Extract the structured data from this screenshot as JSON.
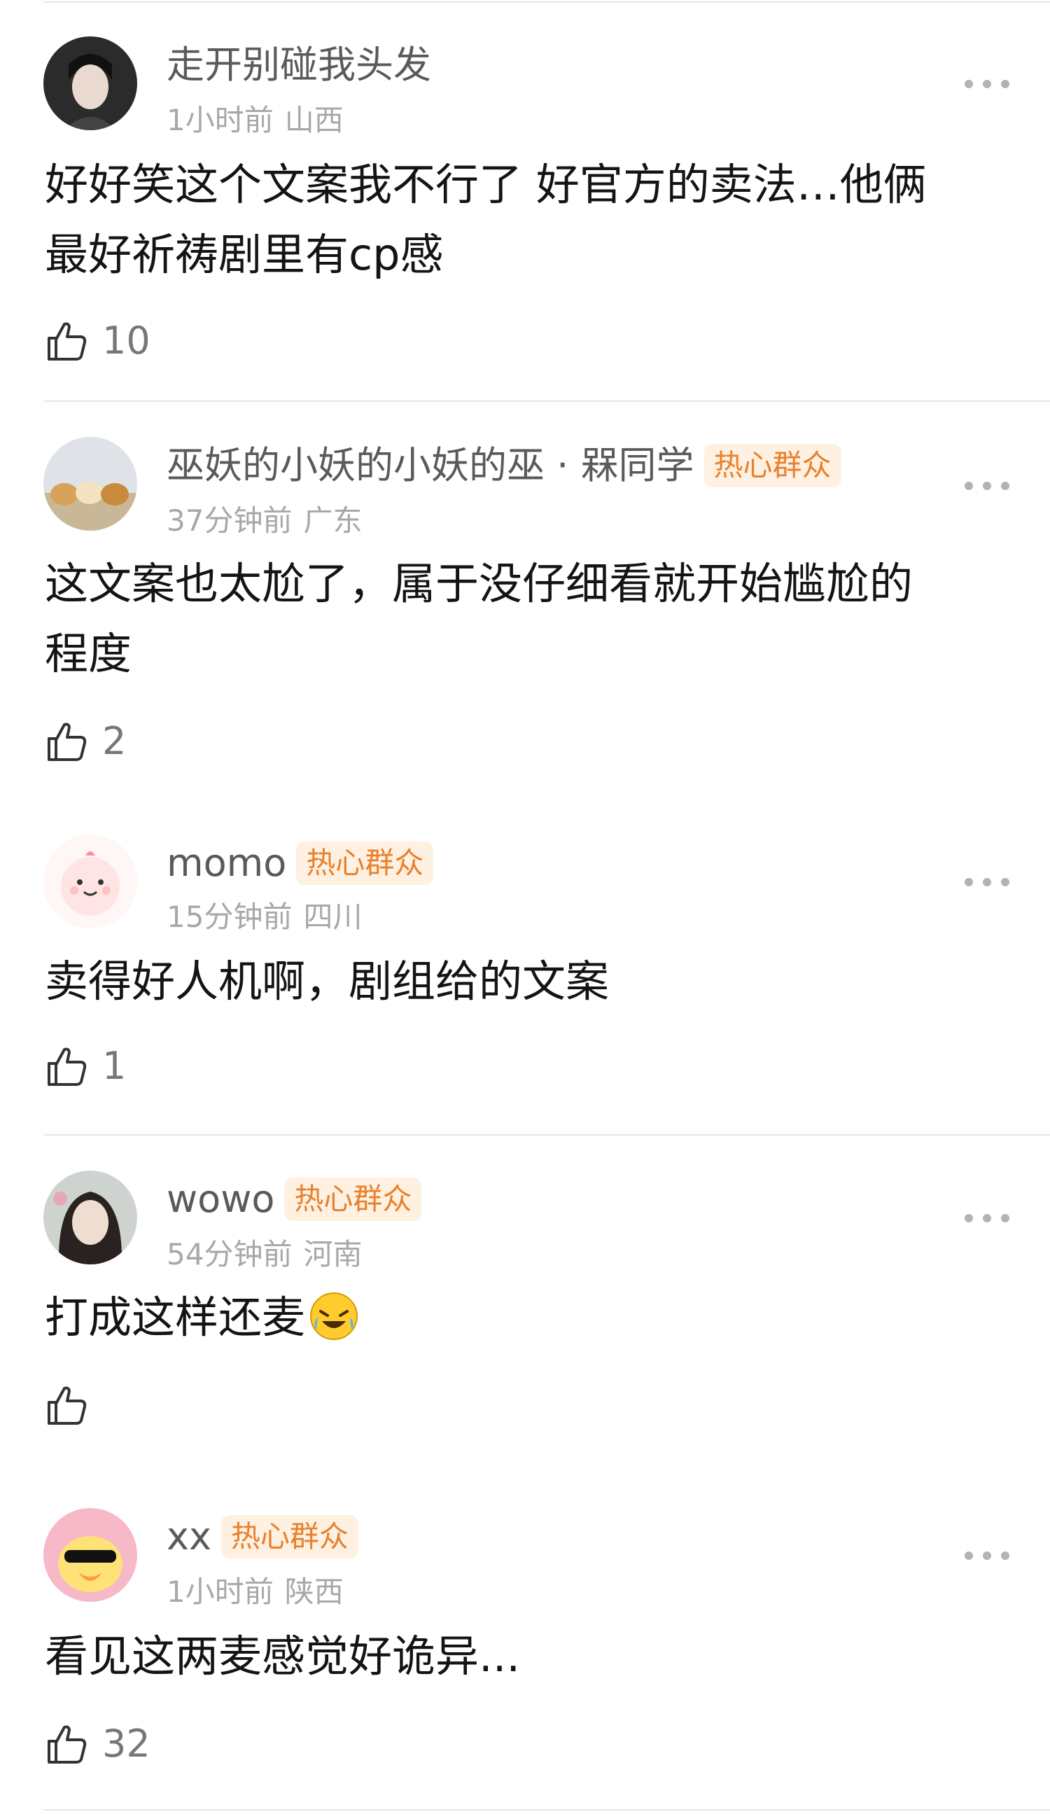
{
  "colors": {
    "badge_text": "#e8812d",
    "badge_bg": "#fff1e2",
    "username": "#5a5a5a",
    "meta": "#a8a8a8",
    "divider": "#e6e6e6"
  },
  "icons": {
    "more": "more-icon",
    "like": "thumbs-up-icon",
    "emoji": "laughing-crying-emoji"
  },
  "comments": [
    {
      "username": "走开别碰我头发",
      "badge": "",
      "time": "1小时前",
      "location": "山西",
      "content_lines": [
        "好好笑这个文案我不行了 好官方的卖法…他俩",
        "最好祈祷剧里有cp感"
      ],
      "likes": "10"
    },
    {
      "username": "巫妖的小妖的小妖的巫 · 槑同学",
      "badge": "热心群众",
      "time": "37分钟前",
      "location": "广东",
      "content_lines": [
        "这文案也太尬了，属于没仔细看就开始尴尬的",
        "程度"
      ],
      "likes": "2"
    },
    {
      "username": "momo",
      "badge": "热心群众",
      "time": "15分钟前",
      "location": "四川",
      "content_lines": [
        "卖得好人机啊，剧组给的文案"
      ],
      "likes": "1"
    },
    {
      "username": "wowo",
      "badge": "热心群众",
      "time": "54分钟前",
      "location": "河南",
      "content_lines": [
        "打成这样还麦"
      ],
      "likes": ""
    },
    {
      "username": "xx",
      "badge": "热心群众",
      "time": "1小时前",
      "location": "陕西",
      "content_lines": [
        "看见这两麦感觉好诡异..."
      ],
      "likes": "32"
    }
  ]
}
